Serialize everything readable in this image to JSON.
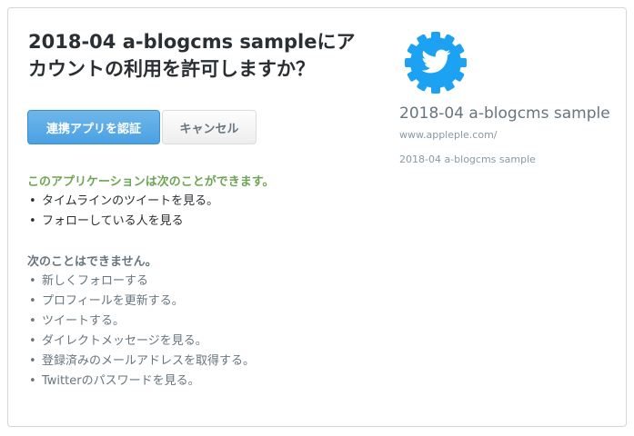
{
  "dialog": {
    "title": "2018-04 a-blogcms sampleにアカウントの利用を許可しますか？",
    "authorize_label": "連携アプリを認証",
    "cancel_label": "キャンセル"
  },
  "permissions": {
    "can_heading": "このアプリケーションは次のことができます。",
    "can_items": [
      "タイムラインのツイートを見る。",
      "フォローしている人を見る"
    ],
    "cannot_heading": "次のことはできません。",
    "cannot_items": [
      "新しくフォローする",
      "プロフィールを更新する。",
      "ツイートする。",
      "ダイレクトメッセージを見る。",
      "登録済みのメールアドレスを取得する。",
      "Twitterのパスワードを見る。"
    ]
  },
  "app": {
    "icon": "twitter-bird-gear-icon",
    "name": "2018-04 a-blogcms sample",
    "url": "www.appleple.com/",
    "description": "2018-04 a-blogcms sample"
  },
  "colors": {
    "primary_button": "#55acee",
    "can_heading": "#6da553",
    "muted_text": "#66757f",
    "icon_blue": "#1da1f2"
  }
}
